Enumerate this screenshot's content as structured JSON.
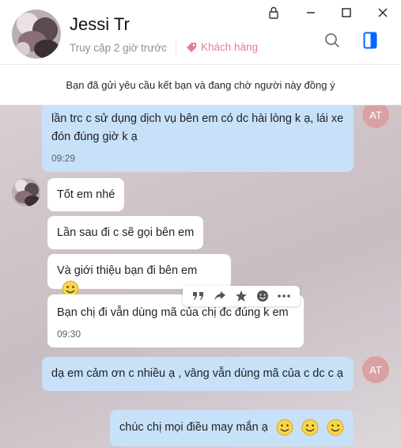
{
  "header": {
    "contact_name": "Jessi Tr",
    "last_seen": "Truy cập 2 giờ trước",
    "tag_label": "Khách hàng"
  },
  "banner": {
    "text": "Bạn đã gửi yêu cầu kết bạn và đang chờ người này đồng ý"
  },
  "colors": {
    "my_bubble": "#c7e1f9",
    "their_bubble": "#ffffff",
    "tag": "#e87d8e",
    "accent": "#0068ff"
  },
  "messages": [
    {
      "from": "me",
      "avatar": "AT",
      "text": "lần trc c sử dụng dịch vụ bên em có dc hài lòng k ạ, lái xe đón đúng giờ k ạ",
      "time": "09:29"
    },
    {
      "from": "them",
      "text": "Tốt em nhé"
    },
    {
      "from": "them",
      "text": "Lần sau đi c sẽ gọi bên em"
    },
    {
      "from": "them",
      "text": "Và giới thiệu bạn đi bên em"
    },
    {
      "from": "them",
      "text": "Bạn chị đi vẫn dùng mã của chị đc đúng k em",
      "time": "09:30"
    },
    {
      "from": "me",
      "avatar": "AT",
      "text": "dạ em cảm ơn c nhiều ạ , vâng vẫn dùng mã của c dc c ạ"
    },
    {
      "from": "me",
      "text": "chúc chị mọi điều may mắn ạ"
    }
  ],
  "message_toolbar": [
    "quote-icon",
    "share-icon",
    "star-icon",
    "emoji-icon",
    "more-icon"
  ]
}
